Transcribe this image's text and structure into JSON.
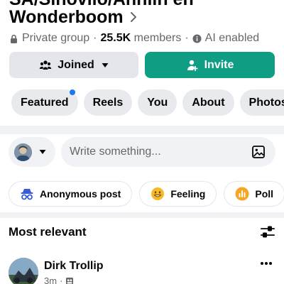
{
  "group": {
    "title_line1": "SA/Sinovilo/Anniin en",
    "title_line2": "Wonderboom",
    "chevron_icon": "chevron-right-icon",
    "privacy_icon": "lock-icon",
    "privacy": "Private group",
    "member_count": "25.5K",
    "members_label": "members",
    "ai_icon": "info-circle-icon",
    "ai_status": "AI enabled",
    "separator": "·"
  },
  "actions": {
    "joined_label": "Joined",
    "joined_icon": "group-people-icon",
    "invite_label": "Invite",
    "invite_icon": "add-person-icon",
    "invite_color": "#0f9d84"
  },
  "tabs": [
    {
      "label": "Featured",
      "has_notification_dot": true
    },
    {
      "label": "Reels"
    },
    {
      "label": "You"
    },
    {
      "label": "About"
    },
    {
      "label": "Photos"
    }
  ],
  "composer": {
    "placeholder": "Write something...",
    "photo_icon": "photo-icon"
  },
  "chips": [
    {
      "label": "Anonymous post",
      "icon": "incognito-icon"
    },
    {
      "label": "Feeling",
      "icon": "smiley-icon"
    },
    {
      "label": "Poll",
      "icon": "poll-icon"
    }
  ],
  "feed": {
    "sort_label": "Most relevant",
    "filter_icon": "sliders-icon"
  },
  "post": {
    "author": "Dirk Trollip",
    "time": "3m",
    "separator": "·",
    "audience_icon": "group-audience-icon",
    "more_icon": "more-horizontal-icon"
  },
  "colors": {
    "accent_green": "#0f9d84",
    "notification_blue": "#1877f2",
    "secondary_text": "#65676b",
    "button_gray": "#e4e6eb"
  }
}
